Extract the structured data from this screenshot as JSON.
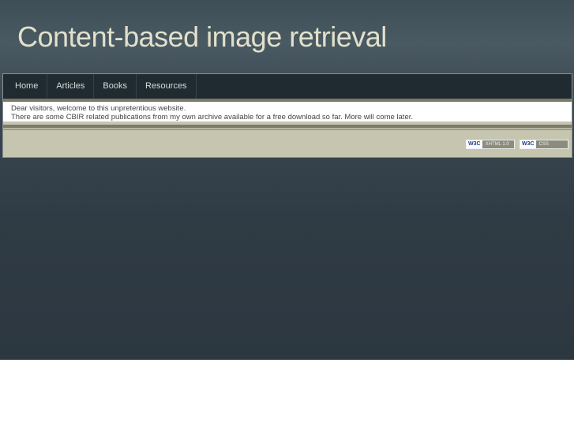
{
  "header": {
    "title": "Content-based image retrieval"
  },
  "nav": {
    "items": [
      "Home",
      "Articles",
      "Books",
      "Resources"
    ]
  },
  "content": {
    "lines": [
      "Dear visitors, welcome to this unpretentious website.",
      "There are some CBIR related publications from my own archive available for a free download so far. More will come later."
    ]
  },
  "footer": {
    "badges": [
      {
        "logo": "W3C",
        "label": "XHTML 1.0"
      },
      {
        "logo": "W3C",
        "label": "CSS"
      }
    ]
  }
}
